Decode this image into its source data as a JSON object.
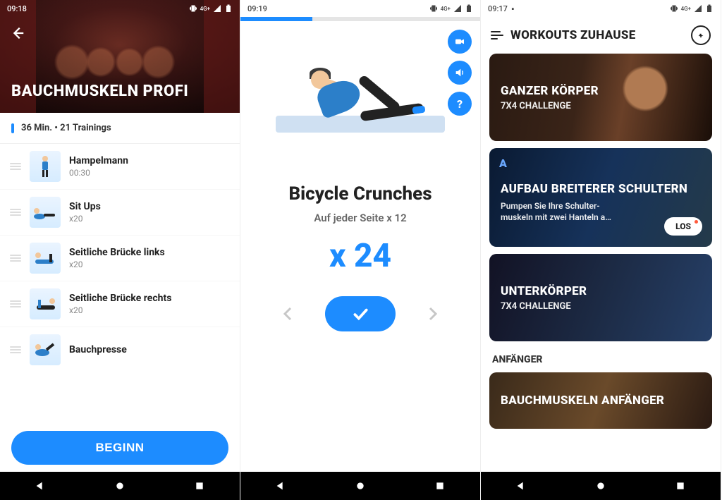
{
  "screen1": {
    "status_time": "09:18",
    "net_label": "4G+",
    "hero_title": "BAUCHMUSKELN PROFI",
    "stats": "36 Min. • 21 Trainings",
    "exercises": [
      {
        "name": "Hampelmann",
        "sub": "00:30"
      },
      {
        "name": "Sit Ups",
        "sub": "x20"
      },
      {
        "name": "Seitliche Brücke links",
        "sub": "x20"
      },
      {
        "name": "Seitliche Brücke rechts",
        "sub": "x20"
      },
      {
        "name": "Bauchpresse",
        "sub": ""
      }
    ],
    "begin_label": "BEGINN"
  },
  "screen2": {
    "status_time": "09:19",
    "net_label": "4G+",
    "exercise_name": "Bicycle Crunches",
    "subline": "Auf jeder Seite x 12",
    "count": "x 24",
    "progress_percent": 30
  },
  "screen3": {
    "status_time": "09:17",
    "net_label": "4G+",
    "header_title": "WORKOUTS ZUHAUSE",
    "cards": [
      {
        "title": "GANZER KÖRPER",
        "sub": "7X4 CHALLENGE"
      },
      {
        "title": "AUFBAU BREITERER SCHULTERN",
        "desc": "Pumpen Sie Ihre Schulter-\nmuskeln mit zwei Hanteln a…",
        "pill": "LOS"
      },
      {
        "title": "UNTERKÖRPER",
        "sub": "7X4 CHALLENGE"
      }
    ],
    "category_label": "ANFÄNGER",
    "card_bottom_title": "BAUCHMUSKELN ANFÄNGER"
  }
}
